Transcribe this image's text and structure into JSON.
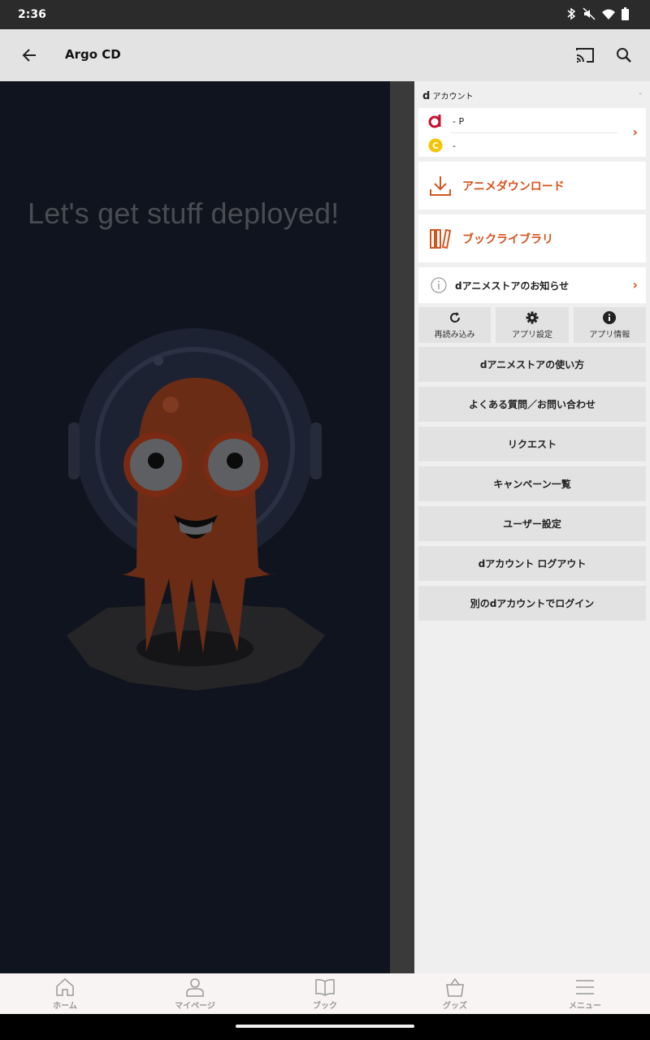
{
  "status_bar": {
    "time": "2:36"
  },
  "app_bar": {
    "title": "Argo CD"
  },
  "content": {
    "hero_text": "Let's get stuff deployed!"
  },
  "drawer": {
    "account_label": "アカウント",
    "account_d": "d",
    "account_dash": "-",
    "d_points": "- P",
    "coin_value": "-",
    "coin_letter": "C",
    "anime_download": "アニメダウンロード",
    "book_library": "ブックライブラリ",
    "notice": "dアニメストアのお知らせ",
    "tri_buttons": [
      {
        "label": "再読み込み",
        "icon": "reload-icon"
      },
      {
        "label": "アプリ設定",
        "icon": "gear-icon"
      },
      {
        "label": "アプリ情報",
        "icon": "info-icon"
      }
    ],
    "menu_items": [
      "dアニメストアの使い方",
      "よくある質問／お問い合わせ",
      "リクエスト",
      "キャンペーン一覧",
      "ユーザー設定",
      "dアカウント ログアウト",
      "別のdアカウントでログイン"
    ]
  },
  "bottom_nav": [
    {
      "label": "ホーム",
      "icon": "home-icon"
    },
    {
      "label": "マイページ",
      "icon": "person-icon"
    },
    {
      "label": "ブック",
      "icon": "book-icon"
    },
    {
      "label": "グッズ",
      "icon": "bag-icon"
    },
    {
      "label": "メニュー",
      "icon": "menu-icon"
    }
  ],
  "colors": {
    "accent": "#d4541e",
    "d_red": "#c8102e",
    "coin_yellow": "#f2c500"
  }
}
